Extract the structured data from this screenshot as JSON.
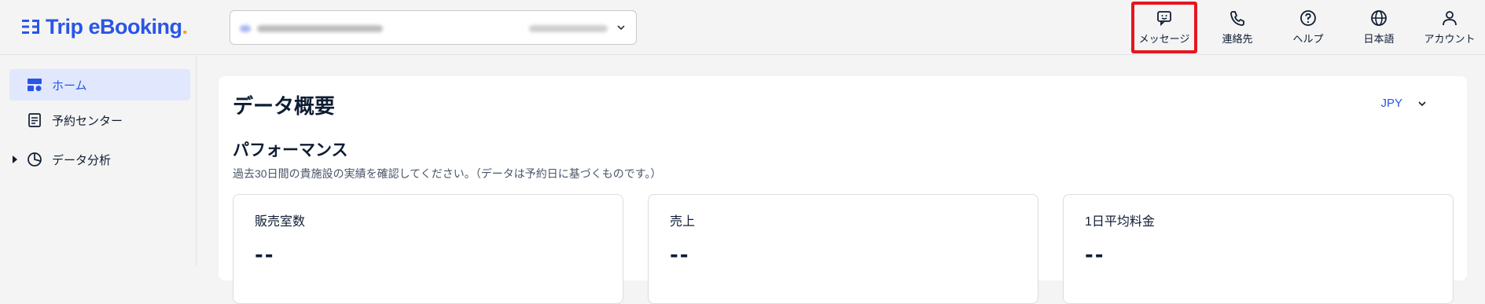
{
  "header": {
    "logo_text": "Trip eBooking",
    "logo_dot": ".",
    "nav": [
      {
        "label": "メッセージ",
        "icon": "message-icon"
      },
      {
        "label": "連絡先",
        "icon": "phone-icon"
      },
      {
        "label": "ヘルプ",
        "icon": "help-icon"
      },
      {
        "label": "日本語",
        "icon": "globe-icon"
      },
      {
        "label": "アカウント",
        "icon": "account-icon"
      }
    ]
  },
  "sidebar": {
    "items": [
      {
        "label": "ホーム",
        "icon": "dashboard-icon"
      },
      {
        "label": "予約センター",
        "icon": "document-icon"
      },
      {
        "label": "データ分析",
        "icon": "pie-chart-icon"
      }
    ]
  },
  "main": {
    "title": "データ概要",
    "currency": "JPY",
    "section_title": "パフォーマンス",
    "section_desc": "過去30日間の貴施設の実績を確認してください。（データは予約日に基づくものです。）",
    "cards": [
      {
        "label": "販売室数",
        "value": "--"
      },
      {
        "label": "売上",
        "value": "--"
      },
      {
        "label": "1日平均料金",
        "value": "--"
      }
    ]
  },
  "colors": {
    "brand": "#2a55e5",
    "accent_dot": "#f7a51a",
    "highlight_border": "#e5161f",
    "active_bg": "#e1e8fd"
  }
}
